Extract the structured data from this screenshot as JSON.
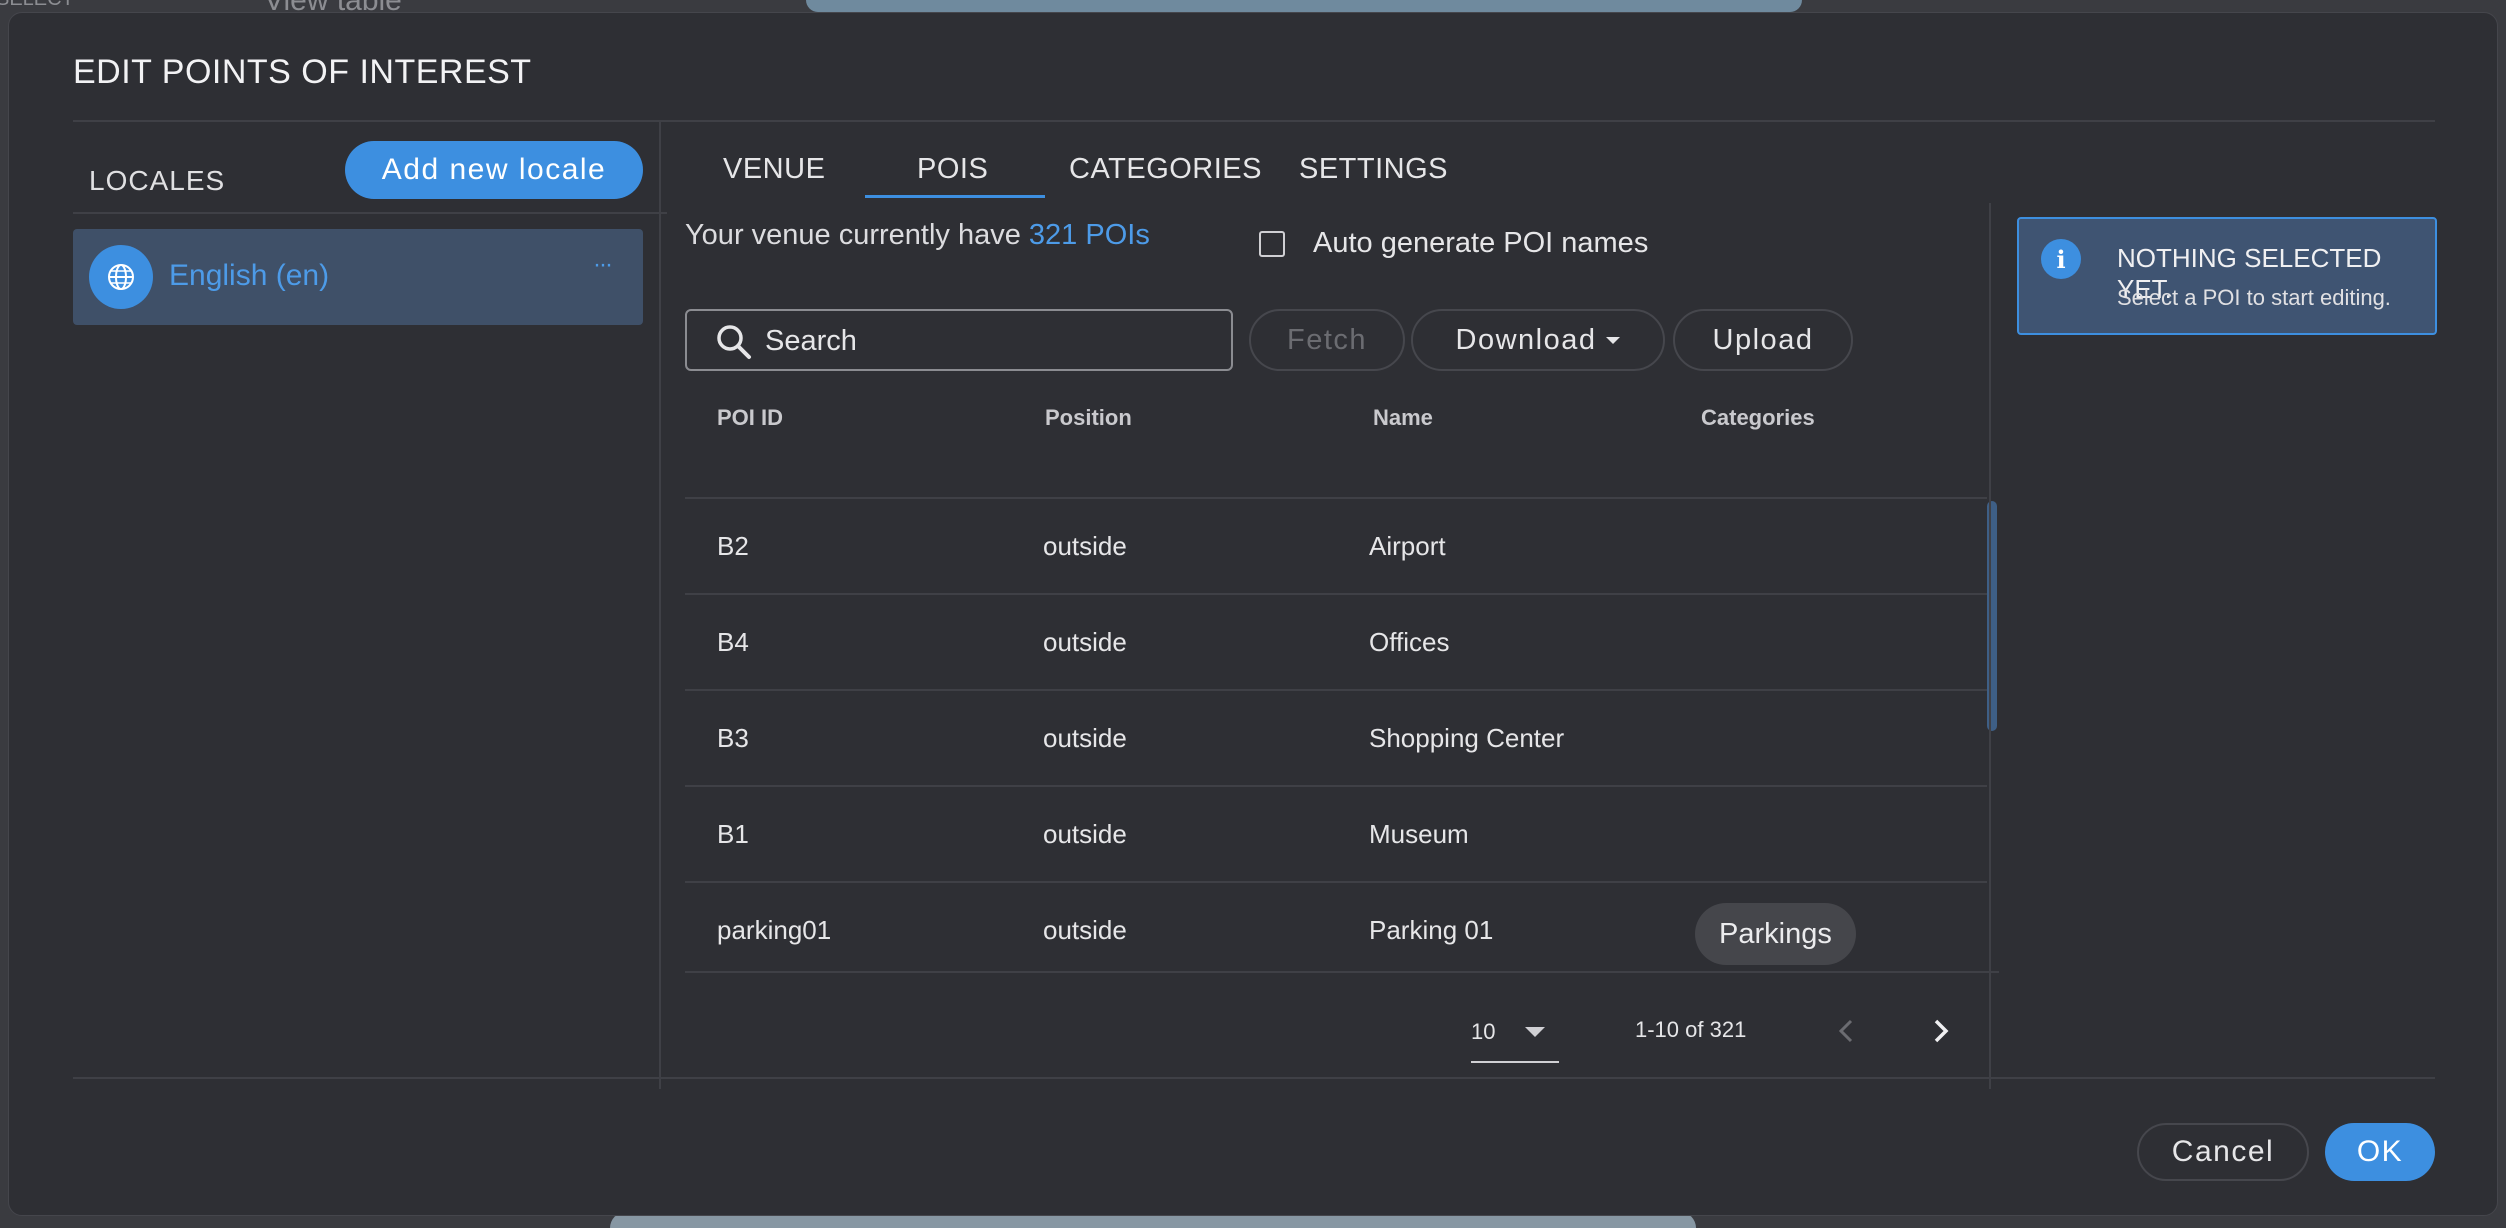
{
  "background": {
    "left_text": "SELECT",
    "tab_text": "View table"
  },
  "dialog": {
    "title": "EDIT POINTS OF INTEREST",
    "locales": {
      "label": "LOCALES",
      "add_button": "Add new locale",
      "items": [
        {
          "label": "English (en)",
          "more": "···",
          "icon": "globe-icon"
        }
      ]
    },
    "tabs": [
      {
        "label": "VENUE",
        "active": false
      },
      {
        "label": "POIS",
        "active": true
      },
      {
        "label": "CATEGORIES",
        "active": false
      },
      {
        "label": "SETTINGS",
        "active": false
      }
    ],
    "venue_info": {
      "prefix": "Your venue currently have ",
      "count_link": "321 POIs"
    },
    "auto_generate": {
      "label": "Auto generate POI names",
      "checked": false
    },
    "toolbar": {
      "search_placeholder": "Search",
      "fetch_label": "Fetch",
      "download_label": "Download",
      "upload_label": "Upload"
    },
    "table": {
      "headers": [
        "POI ID",
        "Position",
        "Name",
        "Categories"
      ],
      "rows": [
        {
          "id": "B2",
          "position": "outside",
          "name": "Airport",
          "categories": ""
        },
        {
          "id": "B4",
          "position": "outside",
          "name": "Offices",
          "categories": ""
        },
        {
          "id": "B3",
          "position": "outside",
          "name": "Shopping Center",
          "categories": ""
        },
        {
          "id": "B1",
          "position": "outside",
          "name": "Museum",
          "categories": ""
        },
        {
          "id": "parking01",
          "position": "outside",
          "name": "Parking 01",
          "categories": "Parkings"
        }
      ]
    },
    "pagination": {
      "rows_per_page": "10",
      "range": "1-10 of 321"
    },
    "info_panel": {
      "title": "NOTHING SELECTED YET.",
      "subtitle": "Select a POI to start editing.",
      "icon": "info-icon"
    },
    "footer": {
      "cancel_label": "Cancel",
      "ok_label": "OK"
    }
  },
  "colors": {
    "accent": "#3d8fe0",
    "dialog_bg": "#2e2f34",
    "selected_bg": "#3f5068",
    "info_bg": "#3f5472"
  }
}
